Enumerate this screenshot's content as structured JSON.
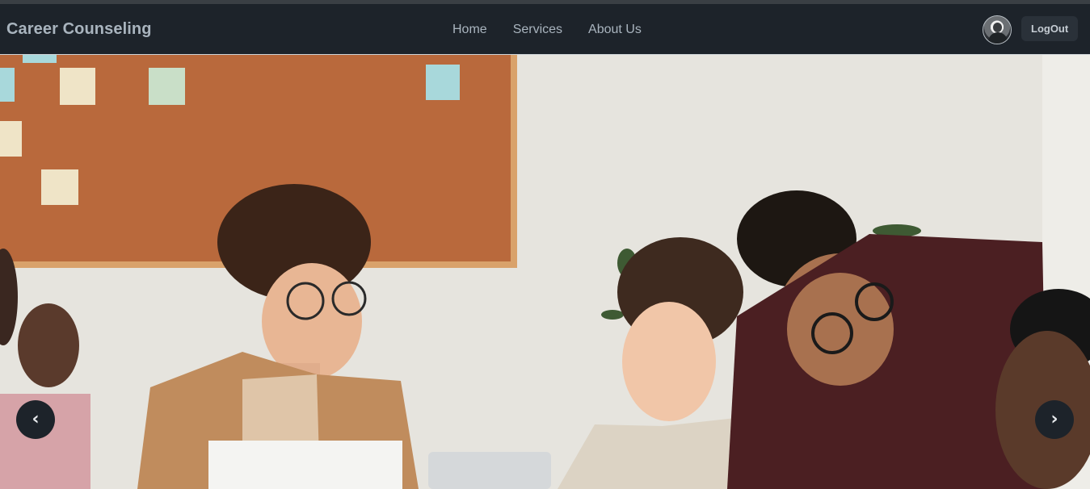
{
  "navbar": {
    "brand": "Career Counseling",
    "links": [
      "Home",
      "Services",
      "About Us"
    ],
    "logout_label": "LogOut",
    "avatar_icon": "user-avatar-icon"
  },
  "hero": {
    "image_description_icon": "team-meeting-photo",
    "prev_glyph": "‹",
    "next_glyph": "›"
  },
  "colors": {
    "navbar_bg": "#1d232a",
    "nav_text": "#a9b4be",
    "button_bg": "#2a3139"
  }
}
